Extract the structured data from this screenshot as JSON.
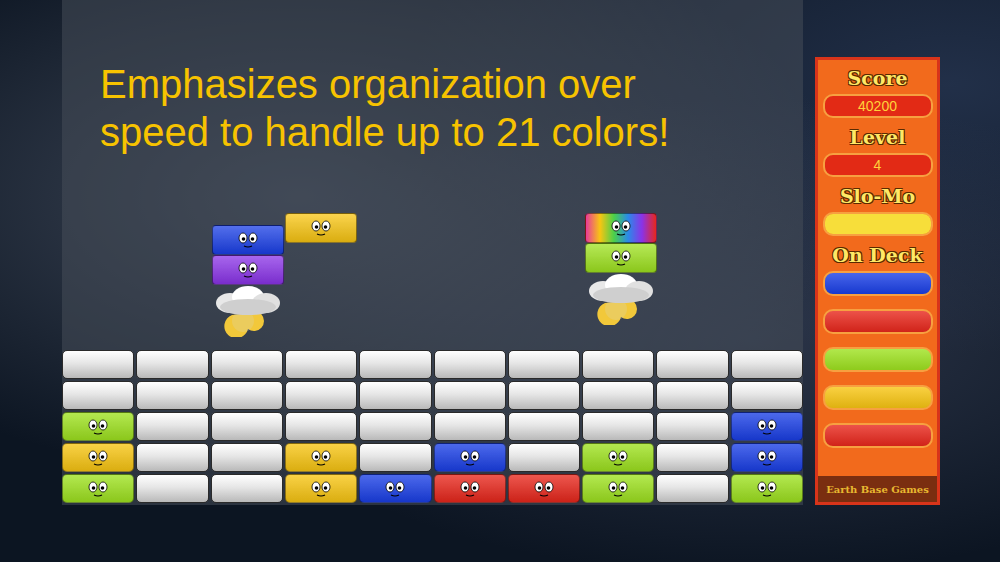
{
  "headline": {
    "lines": [
      "Emphasizes organization over",
      "speed to handle up to 21 colors!"
    ]
  },
  "pieces": [
    {
      "cloud": true,
      "blocks": [
        {
          "kind": "block",
          "color": "#1a3fe6"
        },
        {
          "kind": "block",
          "color": "#8a33e8"
        }
      ]
    },
    {
      "cloud": false,
      "blocks": [
        {
          "kind": "block",
          "color": "#f8c512"
        }
      ]
    },
    {
      "cloud": true,
      "blocks": [
        {
          "kind": "rainbow",
          "color": "#e83a9a"
        },
        {
          "kind": "block",
          "color": "#9ee21f"
        }
      ]
    }
  ],
  "grid": {
    "rows": [
      [
        {
          "kind": "empty"
        },
        {
          "kind": "empty"
        },
        {
          "kind": "empty"
        },
        {
          "kind": "empty"
        },
        {
          "kind": "empty"
        },
        {
          "kind": "empty"
        },
        {
          "kind": "empty"
        },
        {
          "kind": "empty"
        },
        {
          "kind": "empty"
        },
        {
          "kind": "empty"
        }
      ],
      [
        {
          "kind": "empty"
        },
        {
          "kind": "empty"
        },
        {
          "kind": "empty"
        },
        {
          "kind": "empty"
        },
        {
          "kind": "empty"
        },
        {
          "kind": "empty"
        },
        {
          "kind": "empty"
        },
        {
          "kind": "empty"
        },
        {
          "kind": "empty"
        },
        {
          "kind": "empty"
        }
      ],
      [
        {
          "kind": "block",
          "color": "#9ee21f"
        },
        {
          "kind": "empty"
        },
        {
          "kind": "empty"
        },
        {
          "kind": "empty"
        },
        {
          "kind": "empty"
        },
        {
          "kind": "empty"
        },
        {
          "kind": "empty"
        },
        {
          "kind": "empty"
        },
        {
          "kind": "empty"
        },
        {
          "kind": "block",
          "color": "#1a3fe6"
        }
      ],
      [
        {
          "kind": "block",
          "color": "#f8c512"
        },
        {
          "kind": "empty"
        },
        {
          "kind": "empty"
        },
        {
          "kind": "block",
          "color": "#f8c512"
        },
        {
          "kind": "empty"
        },
        {
          "kind": "block",
          "color": "#1a3fe6"
        },
        {
          "kind": "empty"
        },
        {
          "kind": "block",
          "color": "#9ee21f"
        },
        {
          "kind": "empty"
        },
        {
          "kind": "block",
          "color": "#1a3fe6"
        }
      ],
      [
        {
          "kind": "block",
          "color": "#9ee21f"
        },
        {
          "kind": "empty"
        },
        {
          "kind": "empty"
        },
        {
          "kind": "block",
          "color": "#f8c512"
        },
        {
          "kind": "block",
          "color": "#1a3fe6"
        },
        {
          "kind": "block",
          "color": "#e8271c"
        },
        {
          "kind": "block",
          "color": "#e8271c"
        },
        {
          "kind": "block",
          "color": "#9ee21f"
        },
        {
          "kind": "empty"
        },
        {
          "kind": "block",
          "color": "#9ee21f"
        }
      ]
    ]
  },
  "panel": {
    "score": {
      "label": "Score",
      "value": "40200"
    },
    "level": {
      "label": "Level",
      "value": "4"
    },
    "slowmo": {
      "label": "Slo-Mo",
      "level": 1
    },
    "on_deck": {
      "label": "On Deck",
      "items": [
        {
          "color": "#1a3fe6"
        },
        {
          "color": "#e8271c"
        },
        {
          "color": "#9ee21f"
        },
        {
          "color": "#f8c512"
        },
        {
          "color": "#e8271c"
        }
      ]
    },
    "footer": "Earth Base Games"
  }
}
